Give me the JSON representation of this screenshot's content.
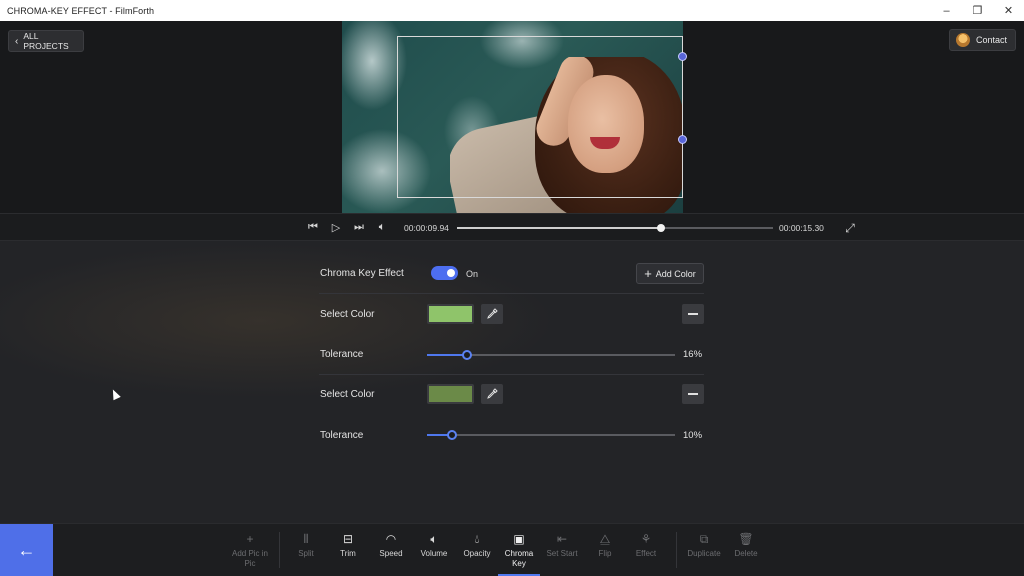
{
  "window": {
    "title": "CHROMA-KEY EFFECT - FilmForth",
    "controls": {
      "minimize": "–",
      "restore": "❐",
      "close": "✕"
    }
  },
  "header": {
    "back_label": "ALL PROJECTS",
    "contact_label": "Contact"
  },
  "playback": {
    "current_time": "00:00:09.94",
    "total_time": "00:00:15.30",
    "progress": 0.645
  },
  "chroma": {
    "effect_label": "Chroma Key Effect",
    "toggle_state": "On",
    "add_color_label": "Add Color",
    "entries": [
      {
        "select_label": "Select Color",
        "color": "#8fc46a",
        "tolerance_label": "Tolerance",
        "tolerance": "16%",
        "tolerance_value": 0.16
      },
      {
        "select_label": "Select Color",
        "color": "#6b8a48",
        "tolerance_label": "Tolerance",
        "tolerance": "10%",
        "tolerance_value": 0.1
      }
    ]
  },
  "toolbar": {
    "tools": [
      {
        "label": "Add Pic in Pic",
        "icon": "plus-icon",
        "enabled": false
      },
      {
        "label": "Split",
        "icon": "split-icon",
        "enabled": false
      },
      {
        "label": "Trim",
        "icon": "trim-icon",
        "enabled": true
      },
      {
        "label": "Speed",
        "icon": "speed-icon",
        "enabled": true
      },
      {
        "label": "Volume",
        "icon": "volume-icon",
        "enabled": true
      },
      {
        "label": "Opacity",
        "icon": "opacity-icon",
        "enabled": true
      },
      {
        "label": "Chroma Key",
        "icon": "chroma-key-icon",
        "enabled": true,
        "active": true
      },
      {
        "label": "Set Start",
        "icon": "set-start-icon",
        "enabled": false
      },
      {
        "label": "Flip",
        "icon": "flip-icon",
        "enabled": false
      },
      {
        "label": "Effect",
        "icon": "effect-icon",
        "enabled": false
      },
      {
        "label": "Duplicate",
        "icon": "duplicate-icon",
        "enabled": false
      },
      {
        "label": "Delete",
        "icon": "delete-icon",
        "enabled": false
      }
    ]
  },
  "colors": {
    "accent": "#4f6fe8",
    "background": "#232427"
  }
}
